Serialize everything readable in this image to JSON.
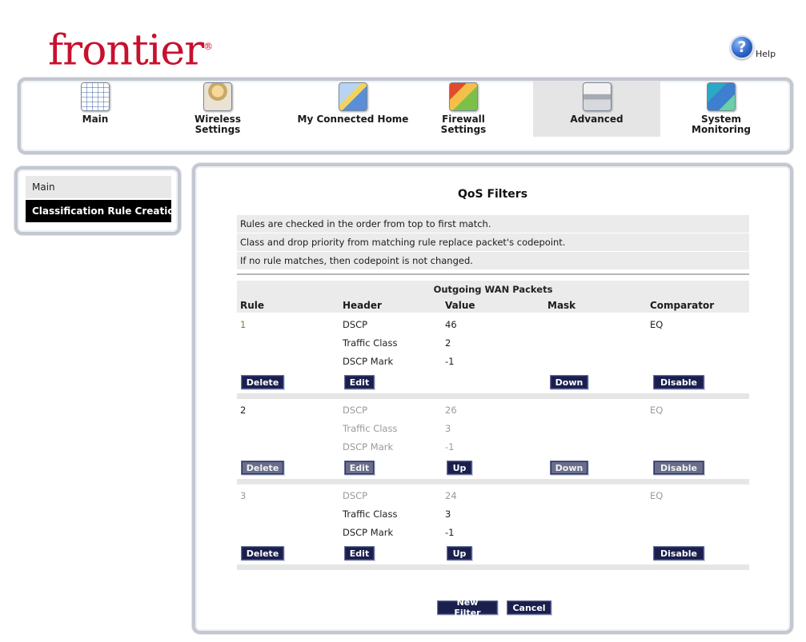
{
  "brand": {
    "logo_text": "frontier",
    "logo_mark": "®",
    "color": "#c8102e"
  },
  "help": {
    "label": "Help",
    "glyph": "?"
  },
  "nav": {
    "items": [
      {
        "label": "Main",
        "icon": "main-grid-icon"
      },
      {
        "label": "Wireless\nSettings",
        "icon": "wireless-router-icon"
      },
      {
        "label": "My Connected Home",
        "icon": "connected-home-icon"
      },
      {
        "label": "Firewall\nSettings",
        "icon": "firewall-icon"
      },
      {
        "label": "Advanced",
        "icon": "advanced-router-icon",
        "active": true
      },
      {
        "label": "System\nMonitoring",
        "icon": "system-monitoring-icon"
      }
    ]
  },
  "sidebar": {
    "items": [
      {
        "label": "Main"
      },
      {
        "label": "Classification Rule Creation",
        "selected": true
      }
    ]
  },
  "main": {
    "title": "QoS Filters",
    "info": [
      "Rules are checked in the order from top to first match.",
      "Class and drop priority from matching rule replace packet's codepoint.",
      "If no rule matches, then codepoint is not changed."
    ],
    "table": {
      "caption": "Outgoing WAN Packets",
      "columns": [
        "Rule",
        "Header",
        "Value",
        "Mask",
        "Comparator"
      ],
      "rules": [
        {
          "rule": "1",
          "rows": [
            {
              "header": "DSCP",
              "value": "46",
              "comparator": "EQ"
            },
            {
              "header": "Traffic Class",
              "value": "2"
            },
            {
              "header": "DSCP Mark",
              "value": "-1"
            }
          ],
          "buttons": {
            "delete": "Delete",
            "edit": "Edit",
            "down": "Down",
            "disable": "Disable"
          }
        },
        {
          "rule": "2",
          "rows": [
            {
              "header": "DSCP",
              "value": "26",
              "comparator": "EQ"
            },
            {
              "header": "Traffic Class",
              "value": "3"
            },
            {
              "header": "DSCP Mark",
              "value": "-1"
            }
          ],
          "buttons": {
            "delete": "Delete",
            "edit": "Edit",
            "up": "Up",
            "down": "Down",
            "disable": "Disable"
          }
        },
        {
          "rule": "3",
          "rows": [
            {
              "header": "DSCP",
              "value": "24",
              "comparator": "EQ"
            },
            {
              "header": "Traffic Class",
              "value": "3"
            },
            {
              "header": "DSCP Mark",
              "value": "-1"
            }
          ],
          "buttons": {
            "delete": "Delete",
            "edit": "Edit",
            "up": "Up",
            "disable": "Disable"
          }
        }
      ]
    },
    "actions": {
      "new_filter": "New Filter",
      "cancel": "Cancel"
    }
  },
  "colors": {
    "button_bg": "#1b1f4d",
    "frame_border": "#c3c7d0",
    "active_tab": "#e5e5e5"
  }
}
